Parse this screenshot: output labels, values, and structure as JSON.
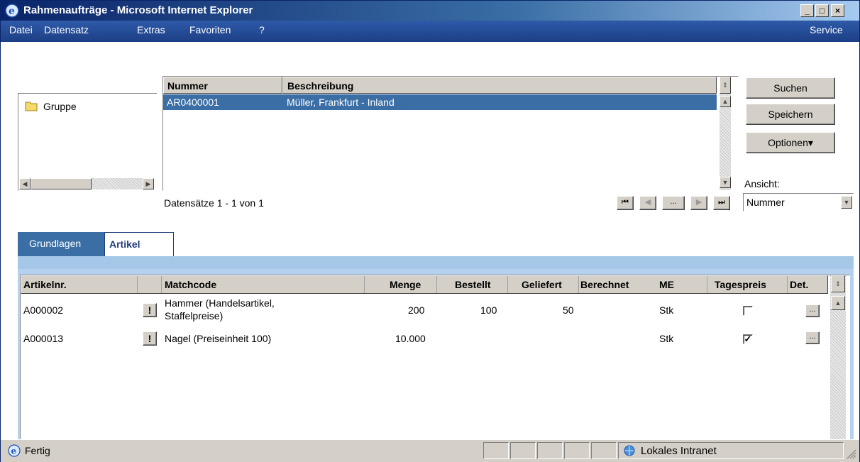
{
  "window": {
    "title": "Rahmenaufträge - Microsoft Internet Explorer",
    "minimize": "_",
    "maximize": "□",
    "close": "×"
  },
  "menu": {
    "items": [
      {
        "label": "Datei"
      },
      {
        "label": "Datensatz"
      },
      {
        "label": "Extras"
      },
      {
        "label": "Favoriten"
      },
      {
        "label": "?"
      }
    ],
    "service": "Service"
  },
  "tree": {
    "item": "Gruppe"
  },
  "records": {
    "columns": [
      "Nummer",
      "Beschreibung"
    ],
    "rows": [
      {
        "nummer": "AR0400001",
        "beschreibung": "Müller, Frankfurt - Inland"
      }
    ],
    "counter": "Datensätze 1 - 1 von 1",
    "nav_more": "..."
  },
  "actions": {
    "search": "Suchen",
    "save": "Speichern",
    "options": "Optionen▾",
    "view_label": "Ansicht:",
    "view_value": "Nummer"
  },
  "tabs": [
    {
      "label": "Grundlagen",
      "active": false
    },
    {
      "label": "Artikel",
      "active": true
    }
  ],
  "articles": {
    "columns": [
      "Artikelnr.",
      "Matchcode",
      "Menge",
      "Bestellt",
      "Geliefert",
      "Berechnet",
      "ME",
      "Tagespreis",
      "Det."
    ],
    "warn_symbol": "!",
    "detail_symbol": "...",
    "rows": [
      {
        "artikelnr": "A000002",
        "matchcode_1": "Hammer (Handelsartikel,",
        "matchcode_2": "Staffelpreise)",
        "menge": "200",
        "bestellt": "100",
        "geliefert": "50",
        "berechnet": "",
        "me": "Stk",
        "tagespreis": false
      },
      {
        "artikelnr": "A000013",
        "matchcode_1": "Nagel (Preiseinheit 100)",
        "matchcode_2": "",
        "menge": "10.000",
        "bestellt": "",
        "geliefert": "",
        "berechnet": "",
        "me": "Stk",
        "tagespreis": true
      }
    ]
  },
  "status": {
    "text": "Fertig",
    "zone": "Lokales Intranet"
  },
  "colors": {
    "titlebar": "#0a246a",
    "menubar": "#2e5aa8",
    "selection": "#3a6ea5",
    "tab_active": "#ffffff",
    "tab_inactive": "#3a6ea5"
  }
}
